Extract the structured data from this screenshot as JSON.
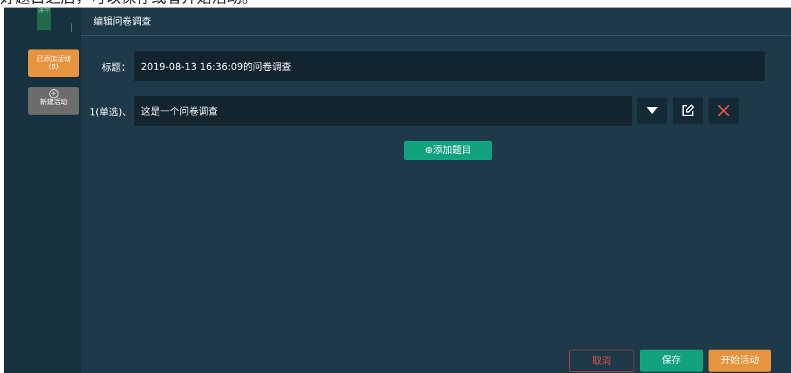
{
  "caption": "好题目之后，可以保存或者开始活动。",
  "rail": {
    "logo_text": "课中",
    "added_label": "已添加活动",
    "added_count": "(8)",
    "new_label": "新建活动",
    "new_icon": "plus-circle-icon"
  },
  "header": {
    "title": "编辑问卷调查"
  },
  "form": {
    "title_label": "标题：",
    "title_value": "2019-08-13 16:36:09的问卷调查",
    "question_label": "1(单选)、",
    "question_value": "这是一个问卷调查",
    "add_question": "⊕添加题目"
  },
  "question_actions": [
    "expand-triangle-icon",
    "edit-icon",
    "delete-x-icon"
  ],
  "footer": {
    "cancel": "取消",
    "save": "保存",
    "start": "开始活动"
  },
  "colors": {
    "rail_bg": "#17323f",
    "main_bg": "#1e3a48",
    "field_bg": "#12252e",
    "green": "#12a37e",
    "orange": "#e8933e",
    "red": "#e14c44"
  }
}
